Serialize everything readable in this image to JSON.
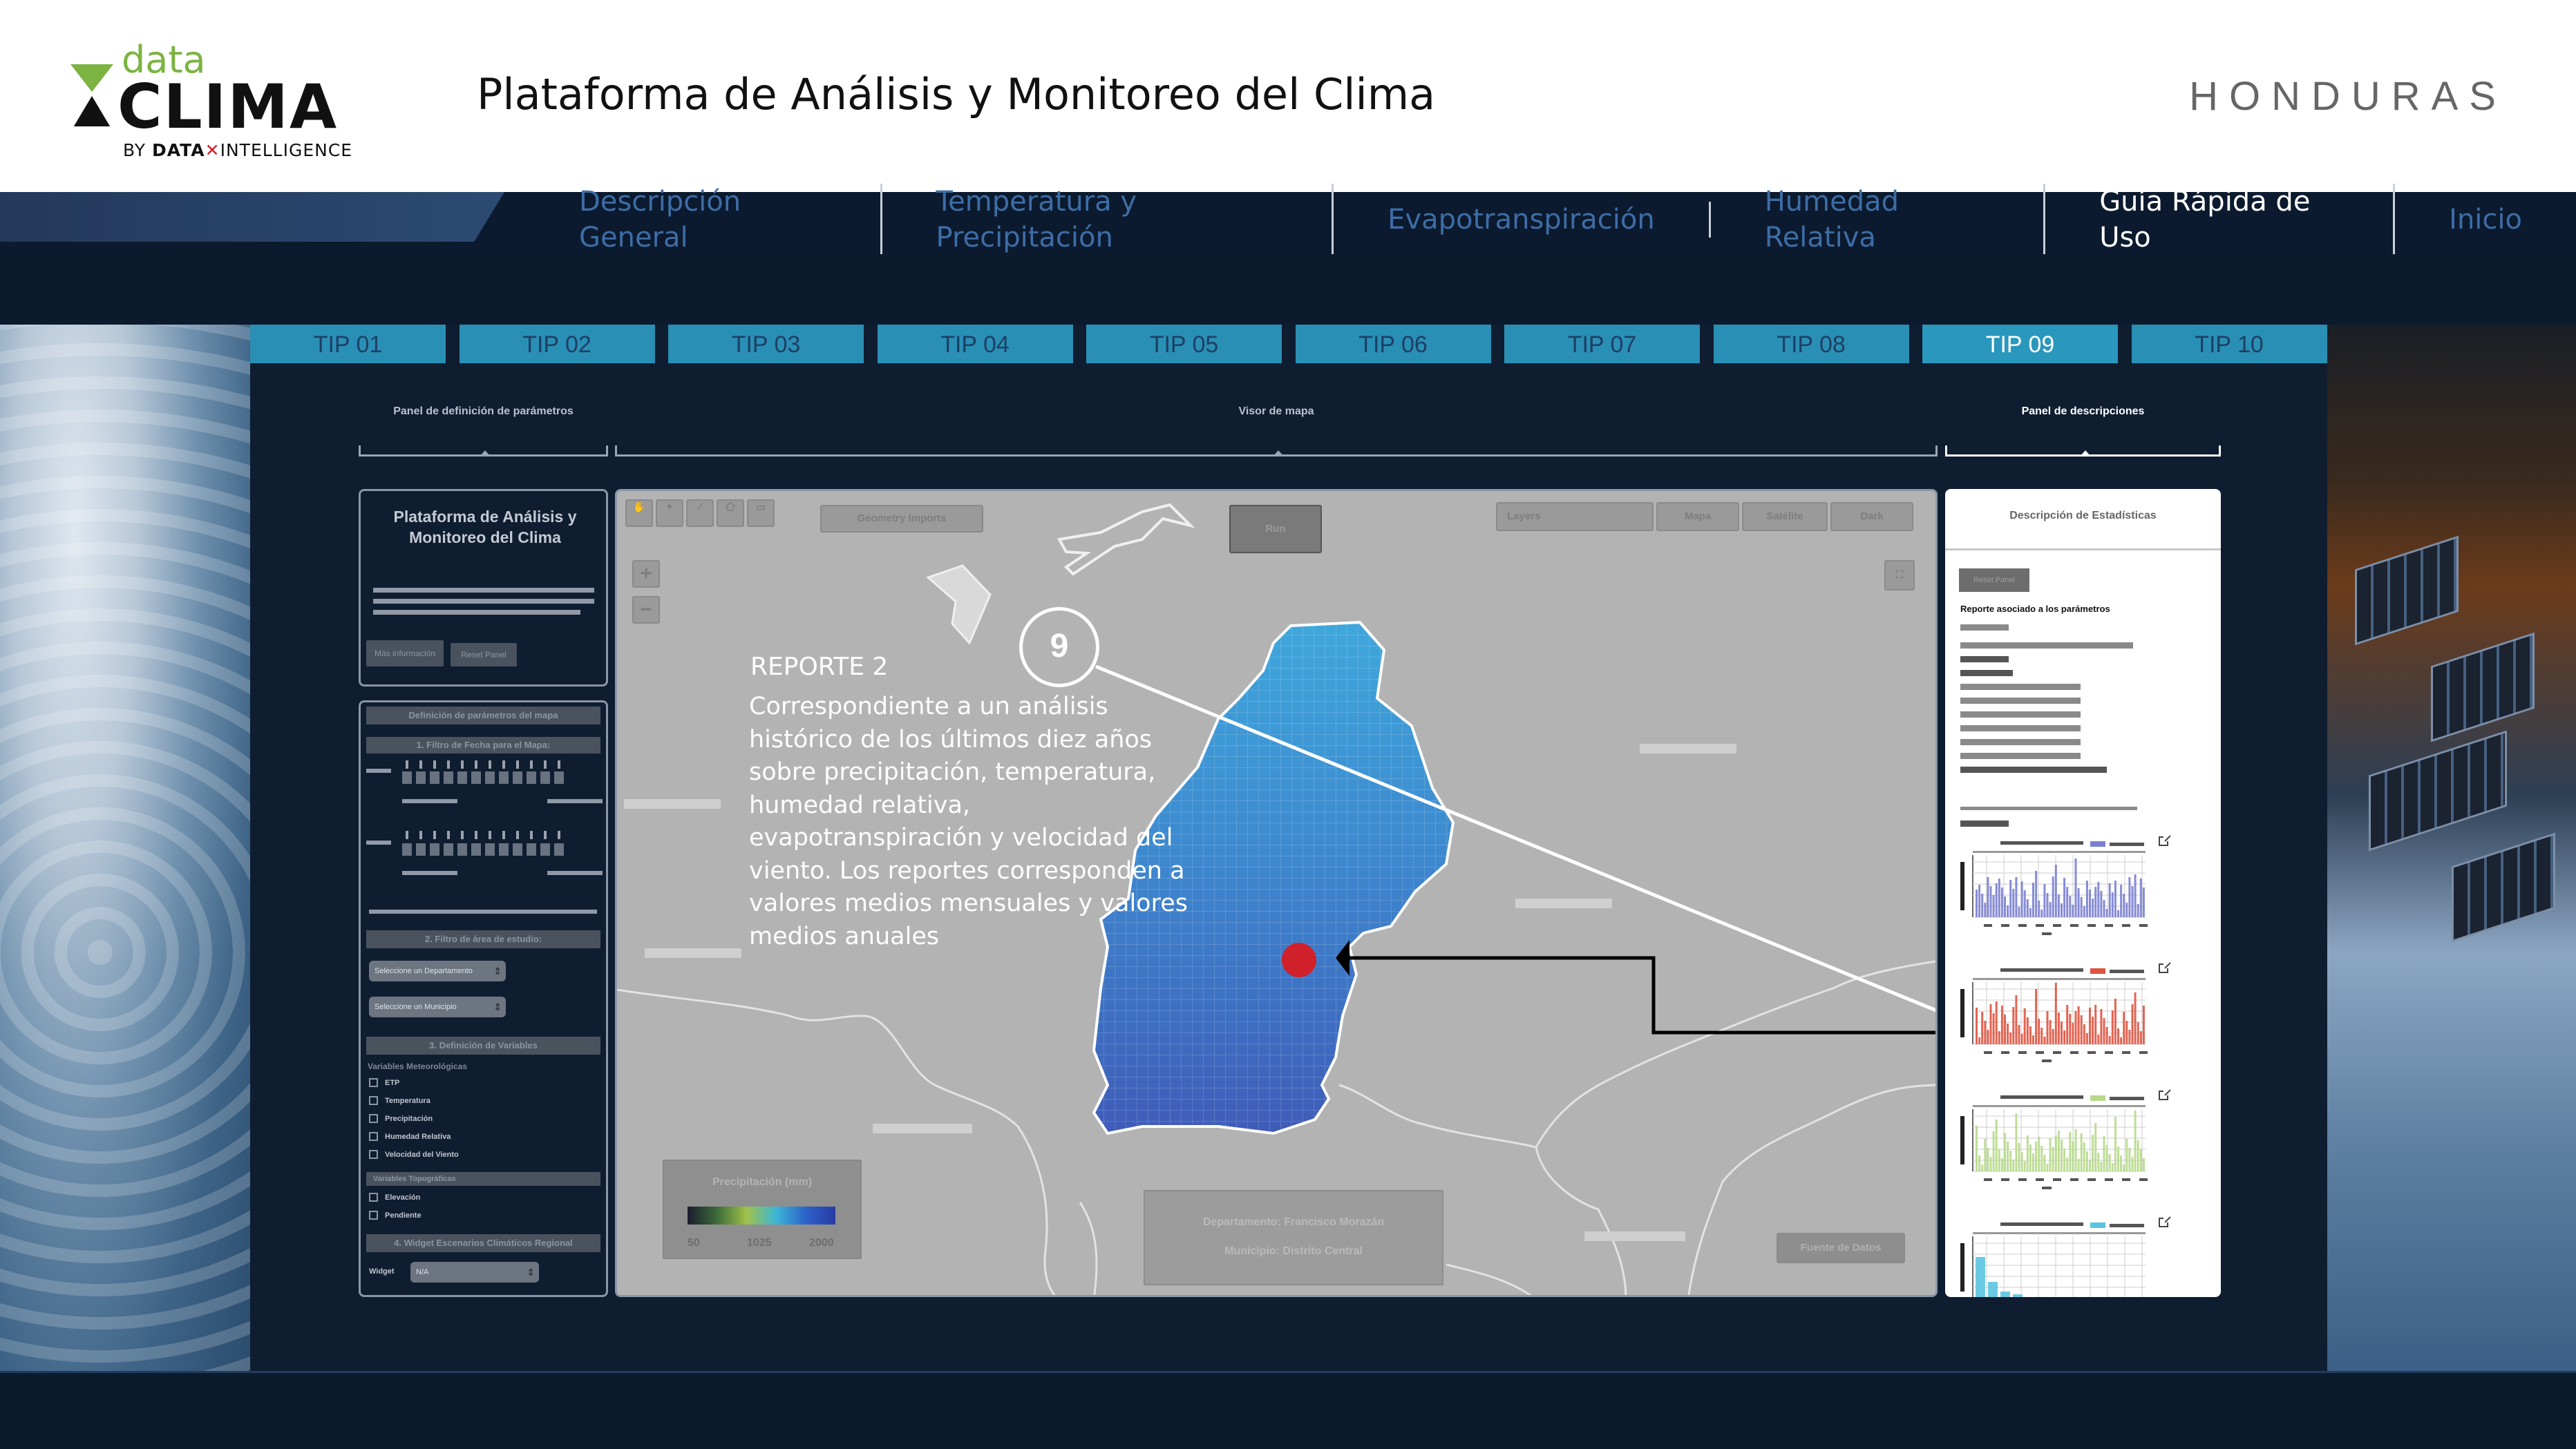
{
  "header": {
    "logo": {
      "top": "data",
      "main": "CLIMA",
      "by": "BY",
      "brand_left": "DATA",
      "brand_right": "INTELLIGENCE"
    },
    "title": "Plataforma de Análisis y Monitoreo del Clima",
    "country": "HONDURAS"
  },
  "nav": {
    "items": [
      {
        "label": "Descripción General",
        "active": false
      },
      {
        "label": "Temperatura y Precipitación",
        "active": false
      },
      {
        "label": "Evapotranspiración",
        "active": false
      },
      {
        "label": "Humedad Relativa",
        "active": false
      },
      {
        "label": "Guía Rápida de Uso",
        "active": true
      },
      {
        "label": "Inicio",
        "active": false
      }
    ]
  },
  "tips": [
    "TIP 01",
    "TIP 02",
    "TIP 03",
    "TIP 04",
    "TIP 05",
    "TIP 06",
    "TIP 07",
    "TIP 08",
    "TIP 09",
    "TIP 10"
  ],
  "active_tip": "TIP 09",
  "sections": {
    "params": "Panel de definición de  parámetros",
    "map": "Visor de mapa",
    "descriptions": "Panel de descripciones"
  },
  "left_panel": {
    "title": "Plataforma de Análisis y Monitoreo del Clima",
    "btn1": "Más información",
    "btn2": "Reset Panel",
    "def_header": "Definición de parámetros del mapa",
    "filter_dates": "1. Filtro de Fecha para el Mapa:",
    "filter_area": "2. Filtro de área de estudio:",
    "select_dept": "Seleccione un Departamento",
    "select_muni": "Seleccione un Municipio",
    "def_vars": "3. Definición de Variables",
    "vars_meteo": "Variables Meteorológicas",
    "variables": [
      "ETP",
      "Temperatura",
      "Precipitación",
      "Humedad Relativa",
      "Velocidad del Viento"
    ],
    "vars_topo": "Variables Topográficas",
    "topo": [
      "Elevación",
      "Pendiente"
    ],
    "widget_header": "4. Widget Escenarios Climáticos Regional",
    "widget_label": "Widget",
    "widget_value": "N/A"
  },
  "map": {
    "geometry": "Geometry Imports",
    "run": "Run",
    "layers": "Layers",
    "mapa": "Mapa",
    "satellite": "Satélite",
    "dark": "Dark",
    "zoom_in": "+",
    "zoom_out": "−",
    "legend_title": "Precipitación (mm)",
    "legend_labels": [
      "50",
      "1025",
      "2000"
    ],
    "dept": "Departamento: Francisco Morazán",
    "muni": "Municipio: Distrito Central",
    "source": "Fuente de Datos"
  },
  "callout": {
    "number": "9",
    "heading": "REPORTE 2",
    "text": "Correspondiente a un análisis histórico de los últimos diez años sobre precipitación, temperatura, humedad relativa, evapotranspiración y velocidad del viento. Los reportes corresponden a valores medios mensuales y valores medios anuales"
  },
  "right_panel": {
    "title": "Descripción de Estadísticas",
    "btn": "Reset Panel",
    "report": "Reporte asociado a los parámetros",
    "charts": [
      {
        "color": "#7a7fd0"
      },
      {
        "color": "#e0533f"
      },
      {
        "color": "#b7d98b"
      },
      {
        "color": "#5bc4e0"
      }
    ]
  },
  "colors": {
    "tip_bg": "#2a8fb4",
    "nav_active": "#ffffff",
    "nav_inactive": "#3e6da6",
    "marker": "#d0202a"
  }
}
